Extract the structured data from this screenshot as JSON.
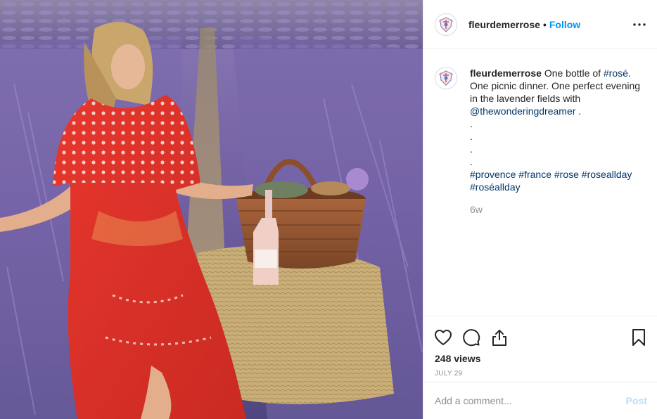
{
  "account": {
    "username": "fleurdemerrose",
    "separator": "•",
    "follow_label": "Follow",
    "more_label": "•••"
  },
  "caption": {
    "username": "fleurdemerrose",
    "text_1": " One bottle of ",
    "hashtag_1": "#rosé",
    "text_2": ". One picnic dinner. One perfect evening in the lavender fields with ",
    "mention": "@thewonderingdreamer",
    "text_3": " .",
    "dots": [
      ".",
      ".",
      ".",
      "."
    ],
    "hashtags": [
      "#provence",
      "#france",
      "#rose",
      "#roseallday",
      "#roséallday"
    ],
    "time_ago": "6w"
  },
  "actions": {
    "like_icon": "heart-icon",
    "comment_icon": "comment-icon",
    "share_icon": "share-icon",
    "save_icon": "bookmark-icon"
  },
  "stats": {
    "views": "248 views",
    "date": "July 29"
  },
  "comment_box": {
    "placeholder": "Add a comment...",
    "post_label": "Post"
  },
  "colors": {
    "link": "#00376b",
    "follow": "#0095f6",
    "muted": "#8e8e8e",
    "post_disabled": "#b2dffc"
  }
}
